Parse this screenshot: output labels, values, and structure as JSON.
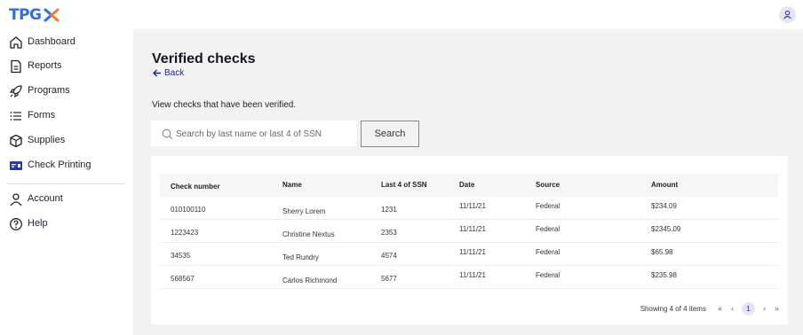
{
  "header": {
    "logo_text": "TPG",
    "brand_color": "#2e6fd8",
    "accent_color": "#f47b2a"
  },
  "sidebar": {
    "items": [
      {
        "label": "Dashboard",
        "icon": "home-icon"
      },
      {
        "label": "Reports",
        "icon": "document-icon"
      },
      {
        "label": "Programs",
        "icon": "rocket-icon"
      },
      {
        "label": "Forms",
        "icon": "list-icon"
      },
      {
        "label": "Supplies",
        "icon": "box-icon"
      },
      {
        "label": "Check Printing",
        "icon": "check-printing-icon",
        "active": true
      },
      {
        "label": "Account",
        "icon": "person-icon"
      },
      {
        "label": "Help",
        "icon": "help-icon"
      }
    ]
  },
  "main": {
    "title": "Verified checks",
    "back_label": "Back",
    "description": "View checks that have been verified.",
    "search_placeholder": "Search by last name or last 4 of SSN",
    "search_button": "Search"
  },
  "table": {
    "columns": [
      "Check number",
      "Name",
      "Last 4 of SSN",
      "Date",
      "Source",
      "Amount"
    ],
    "rows": [
      [
        "010100110",
        "Sherry Lorem",
        "1231",
        "11/11/21",
        "Federal",
        "$234.09"
      ],
      [
        "1223423",
        "Christine Nextus",
        "2353",
        "11/11/21",
        "Federal",
        "$2345.09"
      ],
      [
        "34535",
        "Ted Rundry",
        "4574",
        "11/11/21",
        "Federal",
        "$65.98"
      ],
      [
        "568567",
        "Carlos Richmond",
        "5677",
        "11/11/21",
        "Federal",
        "$235.98"
      ]
    ]
  },
  "pagination": {
    "summary": "Showing 4 of 4 items",
    "first": "«",
    "prev": "‹",
    "current_page": "1",
    "next": "›",
    "last": "»"
  }
}
